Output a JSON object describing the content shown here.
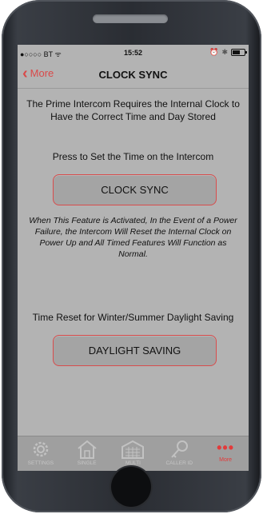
{
  "status_bar": {
    "carrier": "●○○○○ BT ᯤ",
    "time": "15:52",
    "icons": [
      "alarm-icon",
      "bluetooth-icon",
      "battery-icon"
    ]
  },
  "nav": {
    "back_label": "More",
    "title": "CLOCK SYNC"
  },
  "content": {
    "intro": "The Prime Intercom Requires the Internal Clock to Have the Correct Time and Day Stored",
    "press_label": "Press to Set the Time on the Intercom",
    "sync_button": "CLOCK SYNC",
    "note": "When This Feature is Activated, In the Event of a Power Failure, the Intercom Will Reset the Internal Clock on Power Up and All Timed Features Will Function as Normal.",
    "dst_label": "Time Reset for Winter/Summer Daylight Saving",
    "dst_button": "DAYLIGHT SAVING"
  },
  "tabbar": {
    "tabs": [
      {
        "label": "SETTINGS",
        "icon": "gear-icon"
      },
      {
        "label": "SINGLE",
        "icon": "house-icon"
      },
      {
        "label": "MULTI",
        "icon": "building-icon"
      },
      {
        "label": "CALLER ID",
        "icon": "key-icon"
      },
      {
        "label": "More",
        "icon": "more-dots-icon"
      }
    ]
  },
  "colors": {
    "accent": "#e33a3a",
    "screen_bg": "#b3b3b3",
    "button_bg": "#a4a4a4"
  }
}
